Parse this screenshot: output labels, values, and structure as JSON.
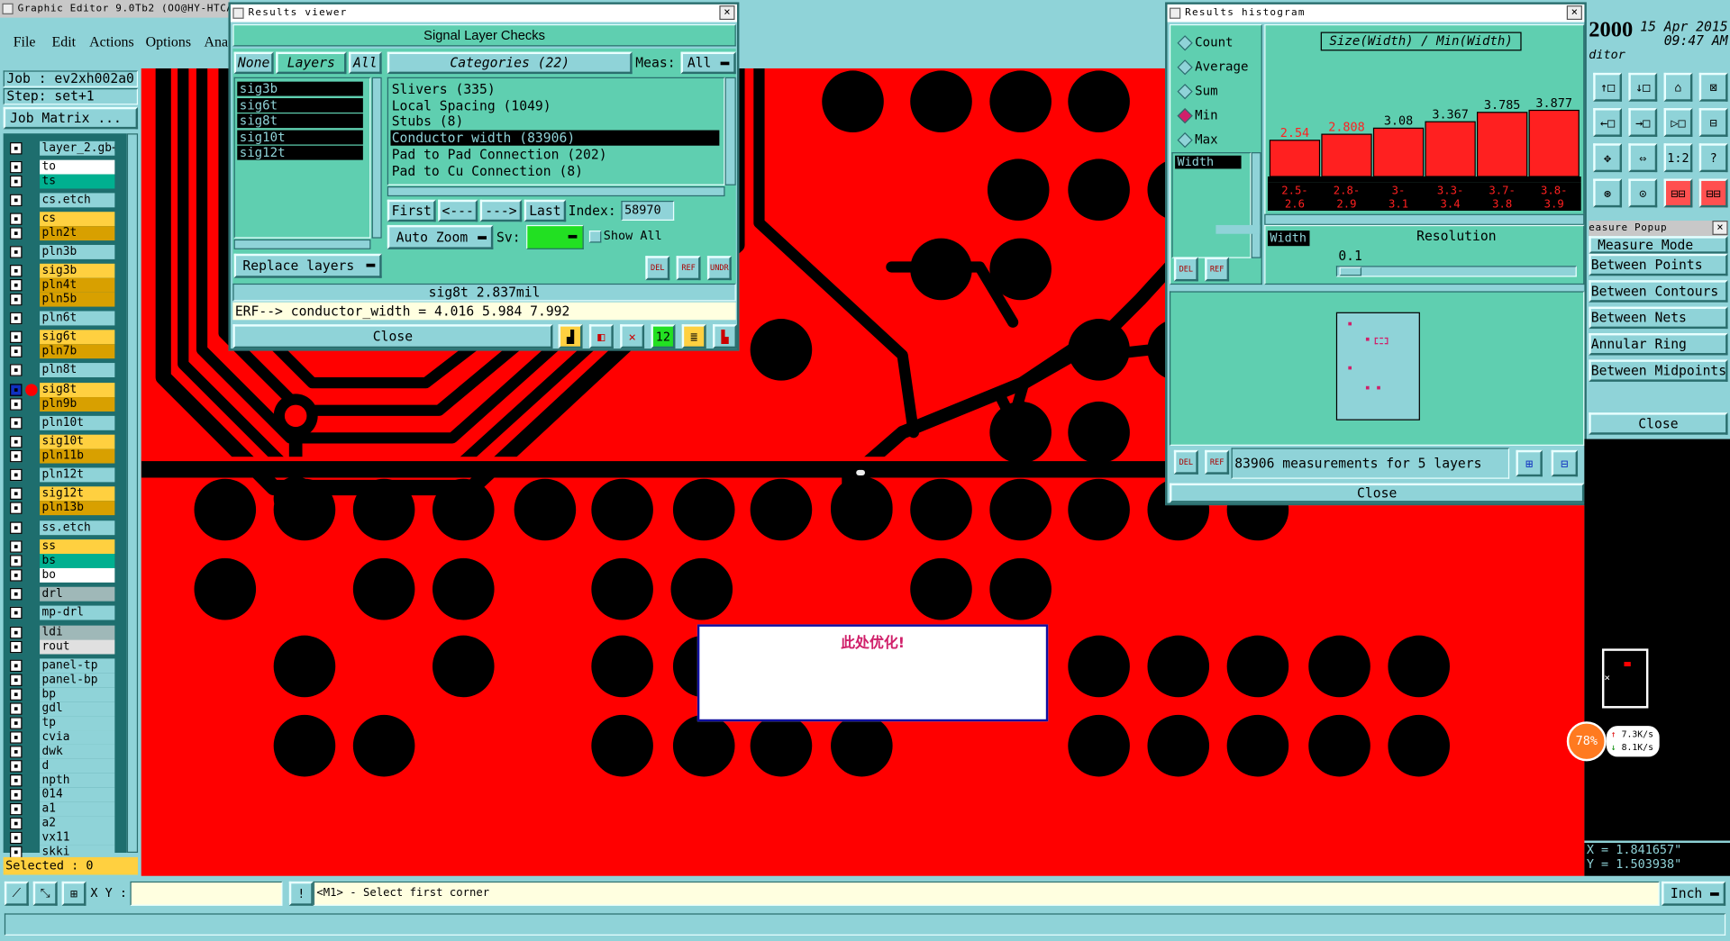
{
  "app_title": "Graphic Editor 9.0Tb2  (OO@HY-HTCA",
  "menu": [
    "File",
    "Edit",
    "Actions",
    "Options",
    "Ana"
  ],
  "job_label": "Job : ev2xh002a0",
  "step_label": "Step: set+1",
  "job_matrix": "Job Matrix ...",
  "layers": [
    {
      "name": "layer_2.gb+",
      "color": "#8fd3d8"
    },
    {
      "name": "to",
      "color": "#ffffff"
    },
    {
      "name": "ts",
      "color": "#00b090"
    },
    {
      "name": "cs.etch",
      "color": "#8fd3d8"
    },
    {
      "name": "cs",
      "color": "#ffd040"
    },
    {
      "name": "pln2t",
      "color": "#d8a000"
    },
    {
      "name": "pln3b",
      "color": "#8fd3d8"
    },
    {
      "name": "sig3b",
      "color": "#ffd040"
    },
    {
      "name": "pln4t",
      "color": "#d8a000"
    },
    {
      "name": "pln5b",
      "color": "#d8a000"
    },
    {
      "name": "pln6t",
      "color": "#8fd3d8"
    },
    {
      "name": "sig6t",
      "color": "#ffd040"
    },
    {
      "name": "pln7b",
      "color": "#d8a000"
    },
    {
      "name": "pln8t",
      "color": "#8fd3d8"
    },
    {
      "name": "sig8t",
      "color": "#ffd040"
    },
    {
      "name": "pln9b",
      "color": "#d8a000"
    },
    {
      "name": "pln10t",
      "color": "#8fd3d8"
    },
    {
      "name": "sig10t",
      "color": "#ffd040"
    },
    {
      "name": "pln11b",
      "color": "#d8a000"
    },
    {
      "name": "pln12t",
      "color": "#8fd3d8"
    },
    {
      "name": "sig12t",
      "color": "#ffd040"
    },
    {
      "name": "pln13b",
      "color": "#d8a000"
    },
    {
      "name": "ss.etch",
      "color": "#8fd3d8"
    },
    {
      "name": "ss",
      "color": "#ffd040"
    },
    {
      "name": "bs",
      "color": "#00b090"
    },
    {
      "name": "bo",
      "color": "#ffffff"
    },
    {
      "name": "drl",
      "color": "#9fb8b8"
    },
    {
      "name": "mp-drl",
      "color": "#8fd3d8"
    },
    {
      "name": "ldi",
      "color": "#9fb8b8"
    },
    {
      "name": "rout",
      "color": "#e0e0e0"
    },
    {
      "name": "panel-tp",
      "color": "#8fd3d8"
    },
    {
      "name": "panel-bp",
      "color": "#8fd3d8"
    },
    {
      "name": "bp",
      "color": "#8fd3d8"
    },
    {
      "name": "gdl",
      "color": "#8fd3d8"
    },
    {
      "name": "tp",
      "color": "#8fd3d8"
    },
    {
      "name": "cvia",
      "color": "#8fd3d8"
    },
    {
      "name": "dwk",
      "color": "#8fd3d8"
    },
    {
      "name": "d",
      "color": "#8fd3d8"
    },
    {
      "name": "npth",
      "color": "#8fd3d8"
    },
    {
      "name": "014",
      "color": "#8fd3d8"
    },
    {
      "name": "a1",
      "color": "#8fd3d8"
    },
    {
      "name": "a2",
      "color": "#8fd3d8"
    },
    {
      "name": "vx11",
      "color": "#8fd3d8"
    },
    {
      "name": "skki",
      "color": "#8fd3d8"
    }
  ],
  "selected_label": "Selected : 0",
  "results_viewer": {
    "title": "Results viewer",
    "header": "Signal Layer Checks",
    "none_label": "None",
    "layers_label": "Layers",
    "all_label": "All",
    "layer_list": [
      "sig3b",
      "sig6t",
      "sig8t",
      "sig10t",
      "sig12t"
    ],
    "categories_label": "Categories (22)",
    "meas_label": "Meas:",
    "meas_value": "All",
    "categories": [
      "Slivers (335)",
      "Local Spacing (1049)",
      "Stubs (8)",
      "Conductor width (83906)",
      "Pad to Pad Connection (202)",
      "Pad to Cu Connection (8)"
    ],
    "selected_category": "Conductor width (83906)",
    "first_label": "First",
    "prev_label": "<---",
    "next_label": "--->",
    "last_label": "Last",
    "index_label": "Index:",
    "index_value": "58970",
    "auto_zoom_label": "Auto Zoom",
    "sv_label": "Sv:",
    "show_all_label": "Show All",
    "replace_layers_label": "Replace layers",
    "status_line": "sig8t 2.837mil",
    "erf_line": "ERF--> conductor_width = 4.016 5.984 7.992",
    "close_label": "Close",
    "icon_labels": [
      "DEL",
      "REF",
      "UNDR"
    ]
  },
  "histogram": {
    "title": "Results histogram",
    "options": [
      "Count",
      "Average",
      "Sum",
      "Min",
      "Max"
    ],
    "selected_option": "Min",
    "field_label": "Width",
    "chart_title": "Size(Width) / Min(Width)",
    "resolution_label": "Resolution",
    "resolution_value": "0.1",
    "width_box": "Width",
    "summary": "83906 measurements for 5 layers",
    "close_label": "Close",
    "icon_labels": [
      "DEL",
      "REF"
    ]
  },
  "chart_data": {
    "type": "bar",
    "title": "Size(Width) / Min(Width)",
    "categories": [
      "2.5-2.6",
      "2.8-2.9",
      "3-3.1",
      "3.3-3.4",
      "3.7-3.8",
      "3.8-3.9"
    ],
    "values": [
      2.54,
      2.808,
      3.08,
      3.367,
      3.785,
      3.877
    ],
    "ylim": [
      0,
      3.877
    ],
    "bar_color": "#ff2020",
    "highlight_labels": [
      "2.54",
      "2.808"
    ]
  },
  "top_right": {
    "year": "2000",
    "date": "15 Apr 2015",
    "time": "09:47 AM",
    "ditor": "ditor"
  },
  "measure_popup": {
    "title": "easure Popup",
    "items": [
      "Measure Mode",
      "Between Points",
      "Between Contours",
      "Between Nets",
      "Annular Ring",
      "Between Midpoints"
    ],
    "close_label": "Close"
  },
  "toolbar_icons": [
    "↑□",
    "↓□",
    "⌂",
    "⊠",
    "←□",
    "→□",
    "▷□",
    "⊟",
    "✥",
    "⇔",
    "1:2",
    "?",
    "⊛",
    "⊙",
    "⊟⊟",
    "⊟⊟"
  ],
  "coords": {
    "x": "X = 1.841657\"",
    "y": "Y = 1.503938\""
  },
  "net_meter": {
    "percent": "78%",
    "up": "7.3K/s",
    "down": "8.1K/s"
  },
  "status_bar": {
    "xy_label": "X Y :",
    "prompt": "<M1> - Select first corner",
    "units": "Inch"
  },
  "popup_note": "此处优化!"
}
